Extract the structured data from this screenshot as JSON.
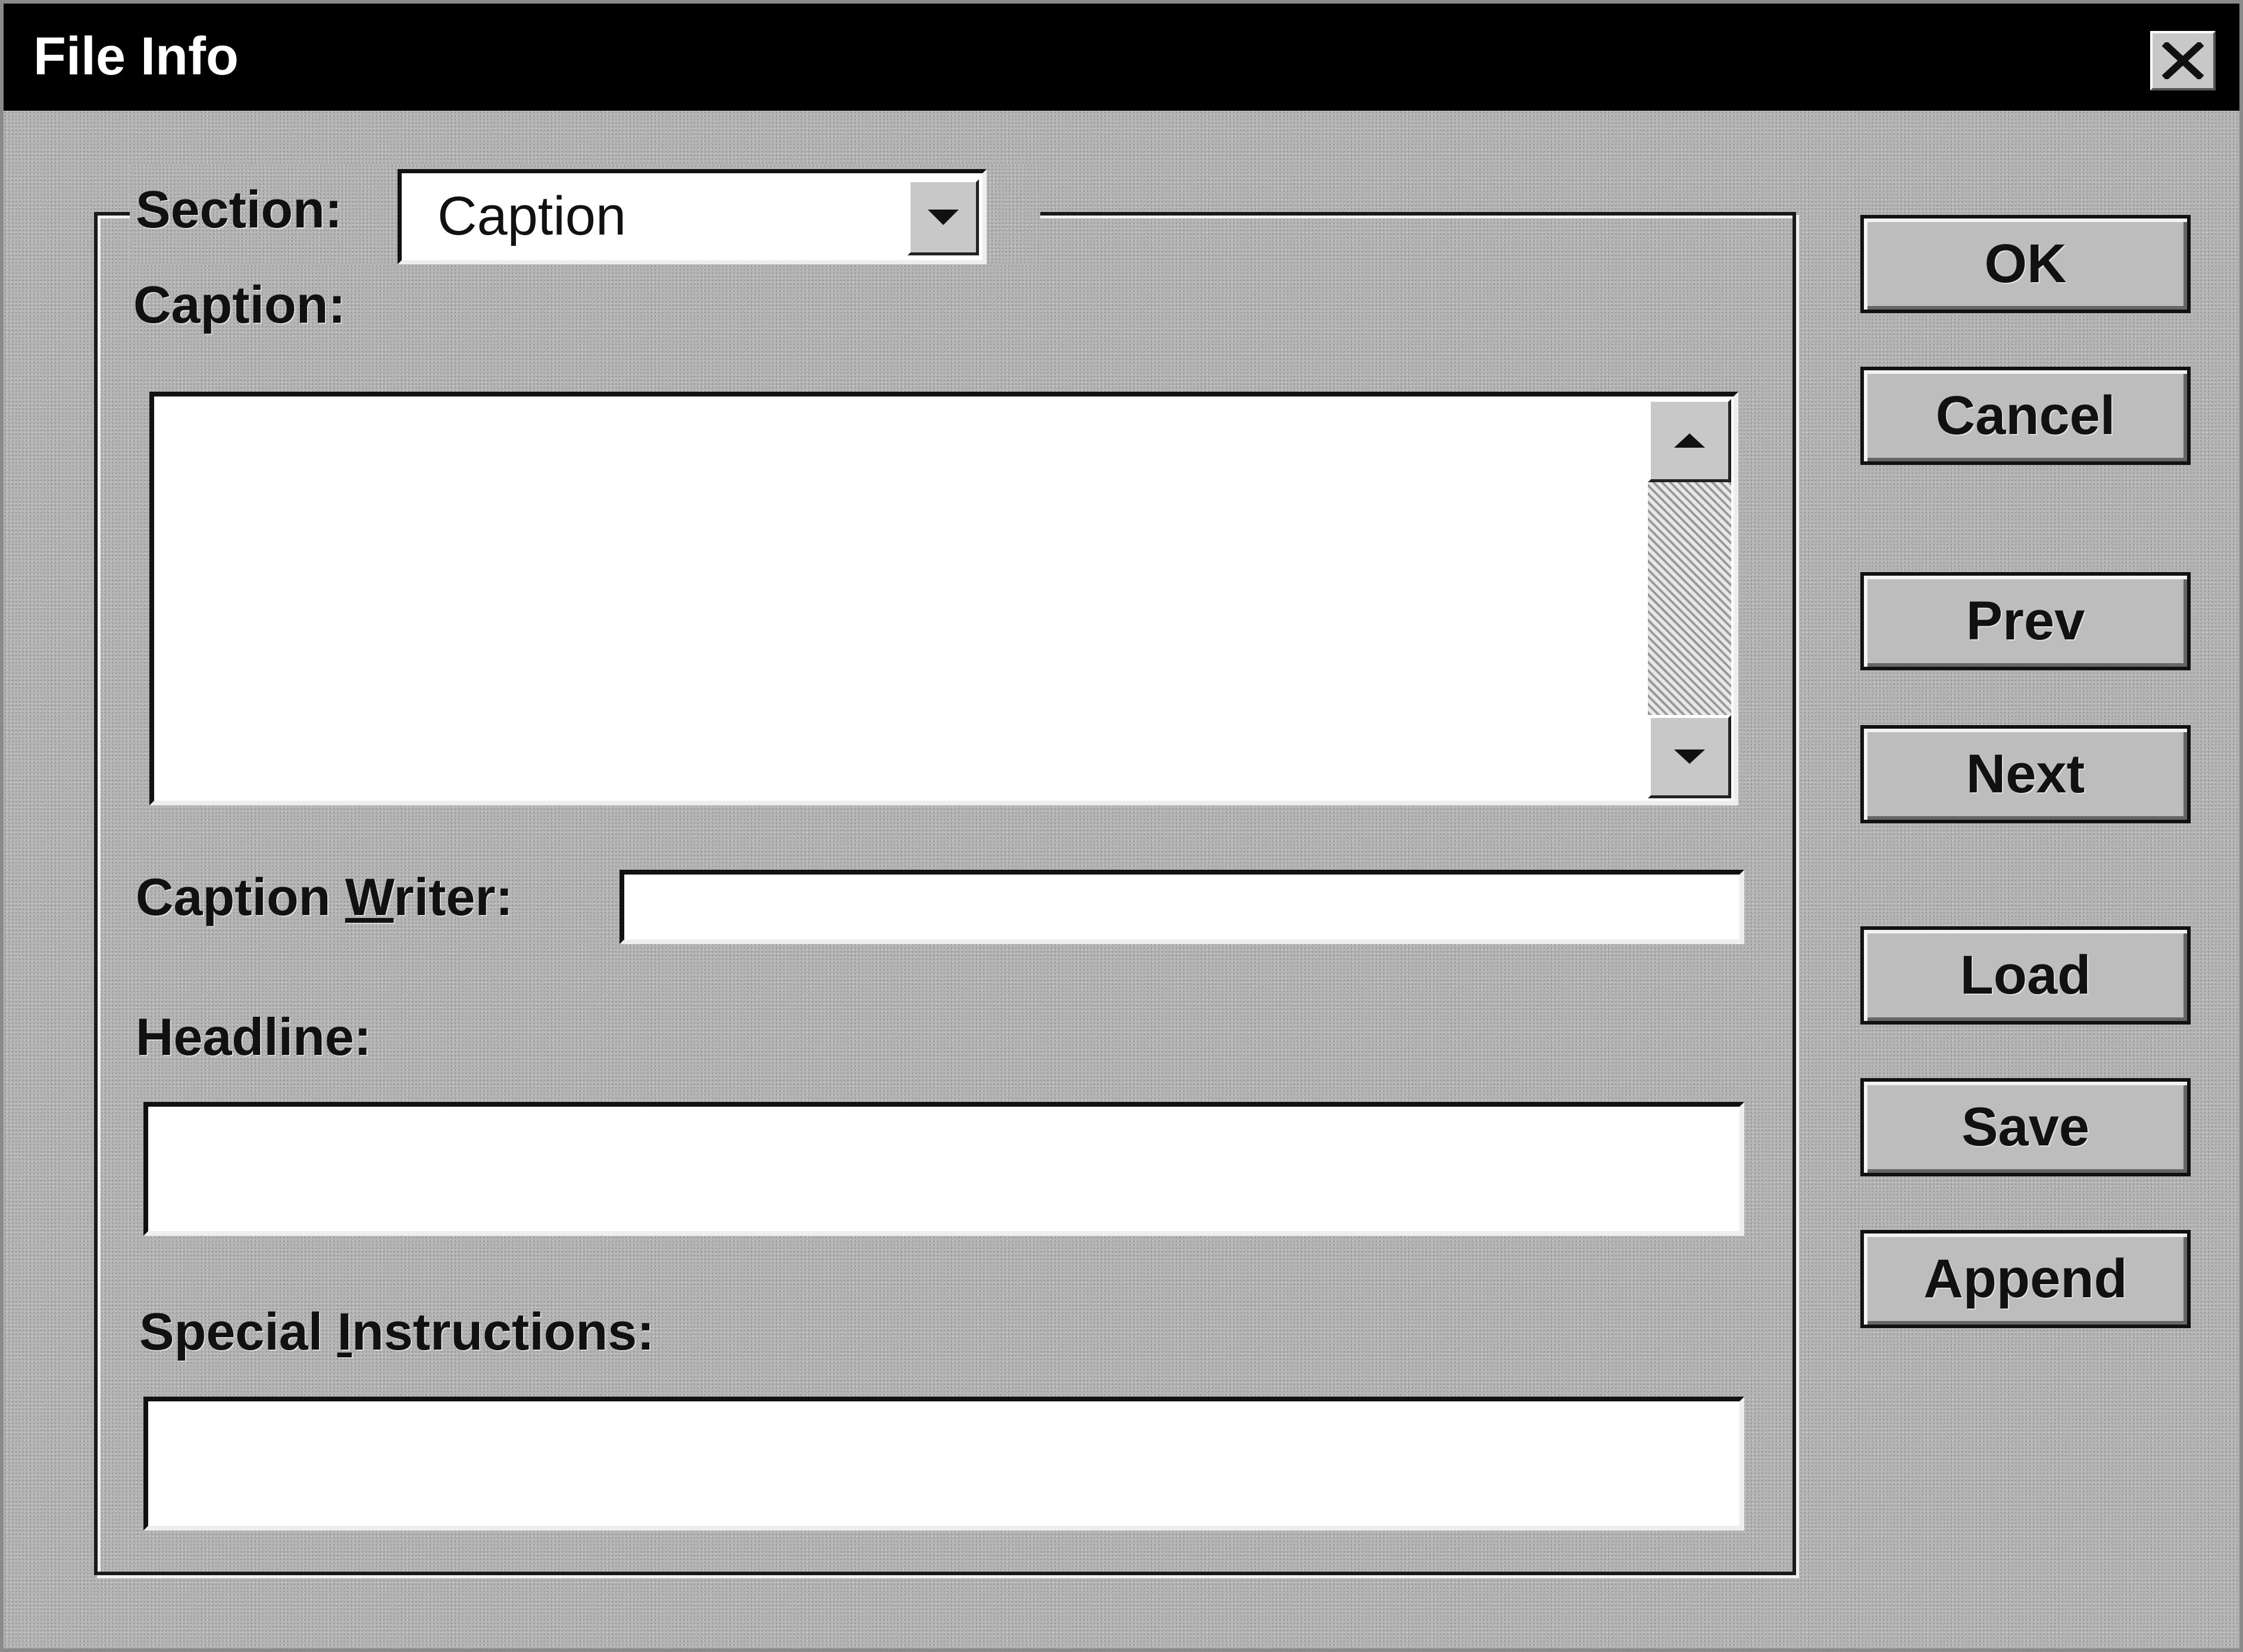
{
  "window": {
    "title": "File Info",
    "close_icon": "close-icon"
  },
  "section": {
    "label": "Section:",
    "selected": "Caption"
  },
  "caption": {
    "label": "Caption:",
    "value": ""
  },
  "caption_writer": {
    "label_prefix": "Caption ",
    "label_accel": "W",
    "label_suffix": "riter:",
    "value": ""
  },
  "headline": {
    "label": "Headline:",
    "value": ""
  },
  "special_instructions": {
    "label_prefix": "Special ",
    "label_accel": "I",
    "label_suffix": "nstructions:",
    "value": ""
  },
  "buttons": {
    "ok": "OK",
    "cancel": "Cancel",
    "prev": "Prev",
    "next": "Next",
    "load": "Load",
    "save": "Save",
    "append": "Append"
  }
}
